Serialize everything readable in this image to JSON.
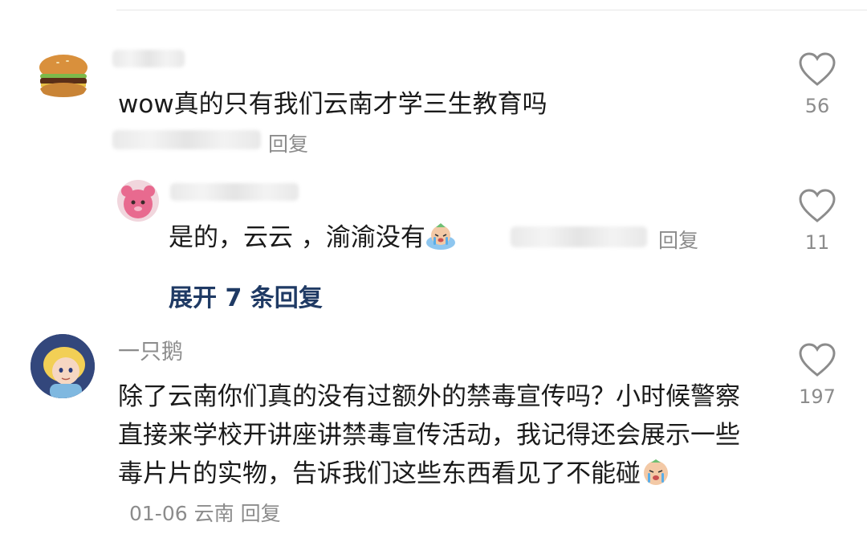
{
  "comments": [
    {
      "text": "wow真的只有我们云南才学三生教育吗",
      "reply_label": "回复",
      "likes": "56",
      "avatar_icon": "hamburger-avatar"
    },
    {
      "text": "是的，云云 ，渝渝没有",
      "emoji_icon": "crying-emoji",
      "reply_label": "回复",
      "likes": "11",
      "avatar_icon": "pink-bear-avatar"
    },
    {
      "username": "一只鹅",
      "text": "除了云南你们真的没有过额外的禁毒宣传吗？小时候警察直接来学校开讲座讲禁毒宣传活动，我记得还会展示一些毒片片的实物，告诉我们这些东西看见了不能碰",
      "emoji_icon": "crying-emoji",
      "date": "01-06",
      "location": "云南",
      "reply_label": "回复",
      "likes": "197",
      "avatar_icon": "cartoon-girl-avatar"
    }
  ],
  "expand_replies_label": "展开 7 条回复",
  "colors": {
    "link": "#1f3a64",
    "muted": "#8c8c8c",
    "text": "#1a1a1a"
  }
}
